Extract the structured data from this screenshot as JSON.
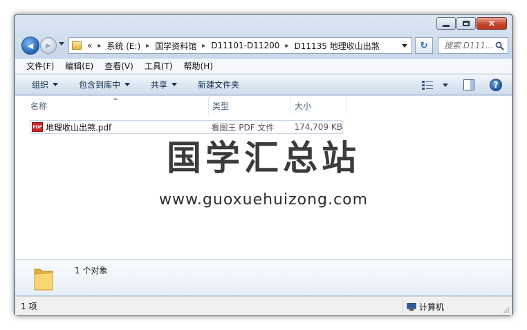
{
  "window": {
    "controls": {
      "minimize": "minimize",
      "maximize": "maximize",
      "close": "×"
    }
  },
  "nav": {
    "back_glyph": "◀",
    "forward_glyph": "▶",
    "breadcrumb_overflow": "«",
    "breadcrumbs": [
      "系统 (E:)",
      "国学资料馆",
      "D11101-D11200",
      "D11135 地理收山出煞"
    ],
    "refresh_glyph": "↻",
    "search_placeholder": "搜索 D111..."
  },
  "menu": [
    "文件(F)",
    "编辑(E)",
    "查看(V)",
    "工具(T)",
    "帮助(H)"
  ],
  "toolbar": {
    "organize": "组织",
    "include_in_library": "包含到库中",
    "share": "共享",
    "new_folder": "新建文件夹",
    "help": "?"
  },
  "columns": {
    "name": "名称",
    "type": "类型",
    "size": "大小"
  },
  "files": [
    {
      "icon": "pdf-icon",
      "icon_text": "PDF",
      "name": "地理收山出煞.pdf",
      "type": "看图王 PDF 文件",
      "size": "174,709 KB"
    }
  ],
  "watermark": {
    "title": "国学汇总站",
    "url": "www.guoxuehuizong.com"
  },
  "details": {
    "summary": "1 个对象"
  },
  "status": {
    "count": "1 项",
    "location": "计算机"
  },
  "colors": {
    "accent": "#1f63b8",
    "close": "#c7452c",
    "frame": "#c9d8ea"
  }
}
